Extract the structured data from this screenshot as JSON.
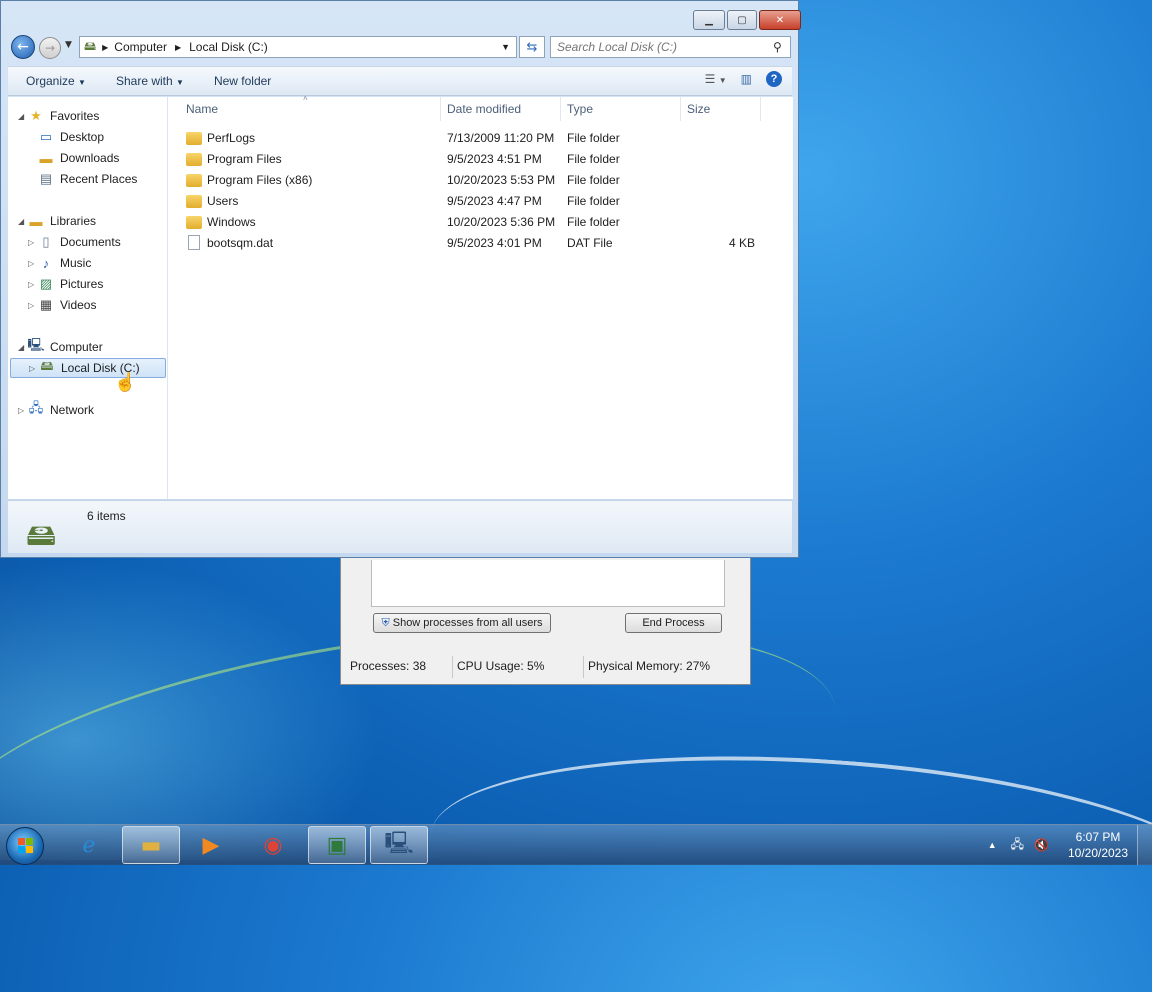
{
  "explorer": {
    "address": {
      "crumbs": [
        "Computer",
        "Local Disk (C:)"
      ]
    },
    "search": {
      "placeholder": "Search Local Disk (C:)"
    },
    "toolbar": {
      "organize": "Organize",
      "share_with": "Share with",
      "new_folder": "New folder",
      "help": "?"
    },
    "nav": {
      "favorites": "Favorites",
      "fav_items": [
        "Desktop",
        "Downloads",
        "Recent Places"
      ],
      "libraries": "Libraries",
      "lib_items": [
        "Documents",
        "Music",
        "Pictures",
        "Videos"
      ],
      "computer": "Computer",
      "local_disk": "Local Disk (C:)",
      "network": "Network"
    },
    "columns": {
      "name": "Name",
      "date": "Date modified",
      "type": "Type",
      "size": "Size"
    },
    "files": [
      {
        "name": "PerfLogs",
        "date": "7/13/2009 11:20 PM",
        "type": "File folder",
        "size": ""
      },
      {
        "name": "Program Files",
        "date": "9/5/2023 4:51 PM",
        "type": "File folder",
        "size": ""
      },
      {
        "name": "Program Files (x86)",
        "date": "10/20/2023 5:53 PM",
        "type": "File folder",
        "size": ""
      },
      {
        "name": "Users",
        "date": "9/5/2023 4:47 PM",
        "type": "File folder",
        "size": ""
      },
      {
        "name": "Windows",
        "date": "10/20/2023 5:36 PM",
        "type": "File folder",
        "size": ""
      },
      {
        "name": "bootsqm.dat",
        "date": "9/5/2023 4:01 PM",
        "type": "DAT File",
        "size": "4 KB"
      }
    ],
    "details": {
      "item_count": "6 items"
    }
  },
  "taskmgr": {
    "show_all": "Show processes from all users",
    "end_process": "End Process",
    "processes": "Processes: 38",
    "cpu": "CPU Usage: 5%",
    "memory": "Physical Memory: 27%"
  },
  "taskbar": {
    "time": "6:07 PM",
    "date": "10/20/2023"
  }
}
